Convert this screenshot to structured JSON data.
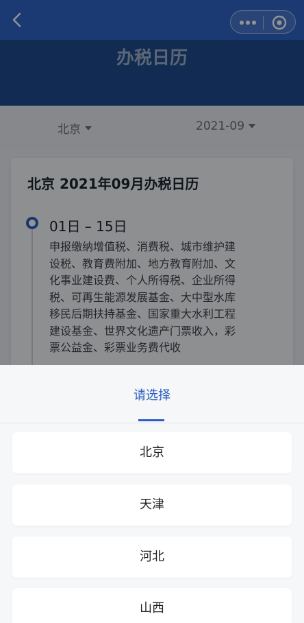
{
  "header": {
    "title": "办税日历"
  },
  "filters": {
    "region": "北京",
    "month": "2021-09"
  },
  "card": {
    "title": "北京 2021年09月办税日历",
    "period": "01日 – 15日",
    "lines": [
      "申报缴纳增值税、消费税、城市维护建",
      "设税、教育费附加、地方教育附加、文",
      "化事业建设费、个人所得税、企业所得",
      "税、可再生能源发展基金、大中型水库",
      "移民后期扶持基金、国家重大水利工程",
      "建设基金、世界文化遗产门票收入，彩",
      "票公益金、彩票业务费代收"
    ]
  },
  "picker": {
    "title": "请选择",
    "options": [
      "北京",
      "天津",
      "河北",
      "山西"
    ]
  },
  "colors": {
    "nav": "#2f64c6",
    "accent": "#2b5fbf",
    "header_band": "#1f4a8e"
  }
}
